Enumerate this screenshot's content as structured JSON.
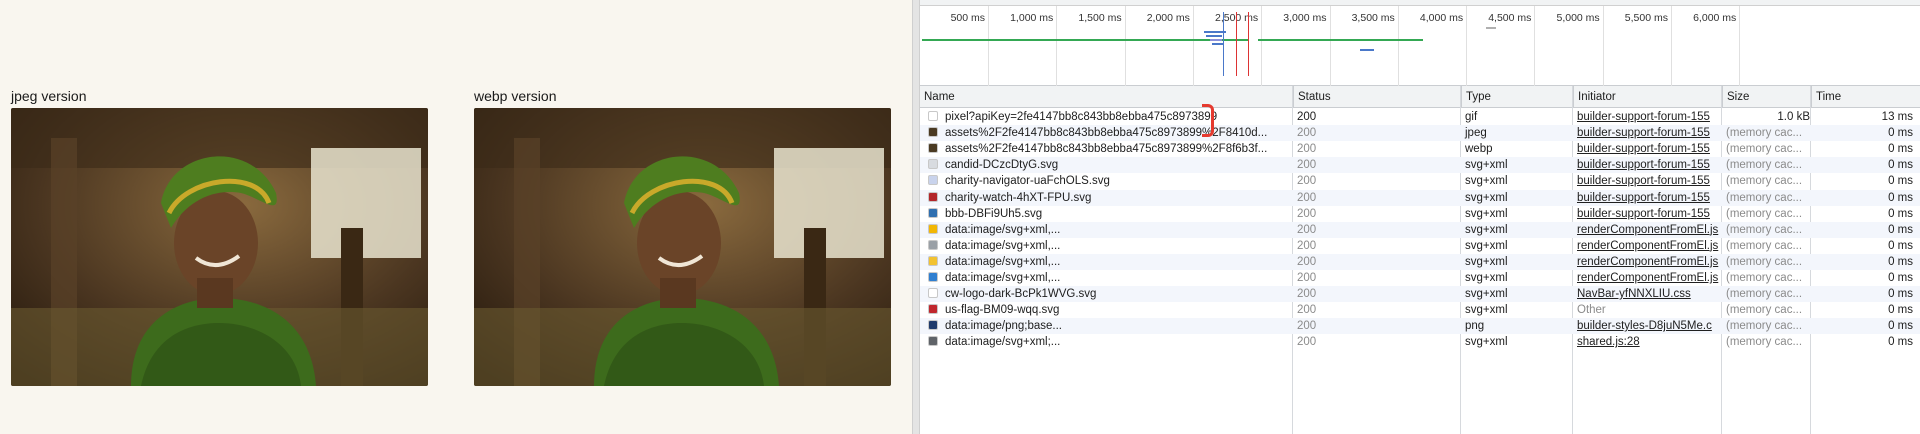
{
  "page": {
    "jpeg_label": "jpeg version",
    "webp_label": "webp version"
  },
  "devtools": {
    "ticks": [
      "500 ms",
      "1,000 ms",
      "1,500 ms",
      "2,000 ms",
      "2,500 ms",
      "3,000 ms",
      "3,500 ms",
      "4,000 ms",
      "4,500 ms",
      "5,000 ms",
      "5,500 ms",
      "6,000 ms"
    ],
    "columns": {
      "name": "Name",
      "status": "Status",
      "type": "Type",
      "initiator": "Initiator",
      "size": "Size",
      "time": "Time"
    },
    "rows": [
      {
        "name": "pixel?apiKey=2fe4147bb8c843bb8ebba475c8973899",
        "status": "200",
        "type": "gif",
        "initiator": "builder-support-forum-155",
        "size": "1.0 kB",
        "time": "13 ms",
        "icon": "blank-file-icon",
        "icon_color": "#ffffff"
      },
      {
        "name": "assets%2F2fe4147bb8c843bb8ebba475c8973899%2F8410d...",
        "status": "200",
        "type": "jpeg",
        "initiator": "builder-support-forum-155",
        "size": "(memory cac...",
        "time": "0 ms",
        "icon": "image-thumbnail-icon",
        "icon_color": "#4a3a22"
      },
      {
        "name": "assets%2F2fe4147bb8c843bb8ebba475c8973899%2F8f6b3f...",
        "status": "200",
        "type": "webp",
        "initiator": "builder-support-forum-155",
        "size": "(memory cac...",
        "time": "0 ms",
        "icon": "image-thumbnail-icon",
        "icon_color": "#4a3a22"
      },
      {
        "name": "candid-DCzcDtyG.svg",
        "status": "200",
        "type": "svg+xml",
        "initiator": "builder-support-forum-155",
        "size": "(memory cac...",
        "time": "0 ms",
        "icon": "document-icon",
        "icon_color": "#d8dbe0"
      },
      {
        "name": "charity-navigator-uaFchOLS.svg",
        "status": "200",
        "type": "svg+xml",
        "initiator": "builder-support-forum-155",
        "size": "(memory cac...",
        "time": "0 ms",
        "icon": "document-icon",
        "icon_color": "#c9d3ec"
      },
      {
        "name": "charity-watch-4hXT-FPU.svg",
        "status": "200",
        "type": "svg+xml",
        "initiator": "builder-support-forum-155",
        "size": "(memory cac...",
        "time": "0 ms",
        "icon": "hat-icon",
        "icon_color": "#b3262a"
      },
      {
        "name": "bbb-DBFi9Uh5.svg",
        "status": "200",
        "type": "svg+xml",
        "initiator": "builder-support-forum-155",
        "size": "(memory cac...",
        "time": "0 ms",
        "icon": "torch-icon",
        "icon_color": "#2f6fb0"
      },
      {
        "name": "data:image/svg+xml,...",
        "status": "200",
        "type": "svg+xml",
        "initiator": "renderComponentFromEl.js",
        "size": "(memory cac...",
        "time": "0 ms",
        "icon": "smiley-icon",
        "icon_color": "#f2b705"
      },
      {
        "name": "data:image/svg+xml,...",
        "status": "200",
        "type": "svg+xml",
        "initiator": "renderComponentFromEl.js",
        "size": "(memory cac...",
        "time": "0 ms",
        "icon": "clock-icon",
        "icon_color": "#9aa0a6"
      },
      {
        "name": "data:image/svg+xml,...",
        "status": "200",
        "type": "svg+xml",
        "initiator": "renderComponentFromEl.js",
        "size": "(memory cac...",
        "time": "0 ms",
        "icon": "note-icon",
        "icon_color": "#f2c230"
      },
      {
        "name": "data:image/svg+xml,...",
        "status": "200",
        "type": "svg+xml",
        "initiator": "renderComponentFromEl.js",
        "size": "(memory cac...",
        "time": "0 ms",
        "icon": "drop-icon",
        "icon_color": "#2f7fd0"
      },
      {
        "name": "cw-logo-dark-BcPk1WVG.svg",
        "status": "200",
        "type": "svg+xml",
        "initiator": "NavBar-yfNNXLIU.css",
        "size": "(memory cac...",
        "time": "0 ms",
        "icon": "blank-file-icon",
        "icon_color": "#ffffff"
      },
      {
        "name": "us-flag-BM09-wqq.svg",
        "status": "200",
        "type": "svg+xml",
        "initiator": "Other",
        "size": "(memory cac...",
        "time": "0 ms",
        "icon": "flag-icon",
        "icon_color": "#c0272d"
      },
      {
        "name": "data:image/png;base...",
        "status": "200",
        "type": "png",
        "initiator": "builder-styles-D8juN5Me.c",
        "size": "(memory cac...",
        "time": "0 ms",
        "icon": "triangle-down-icon",
        "icon_color": "#1f3a6b"
      },
      {
        "name": "data:image/svg+xml;...",
        "status": "200",
        "type": "svg+xml",
        "initiator": "shared.js:28",
        "size": "(memory cac...",
        "time": "0 ms",
        "icon": "gear-icon",
        "icon_color": "#5f6368"
      }
    ]
  }
}
